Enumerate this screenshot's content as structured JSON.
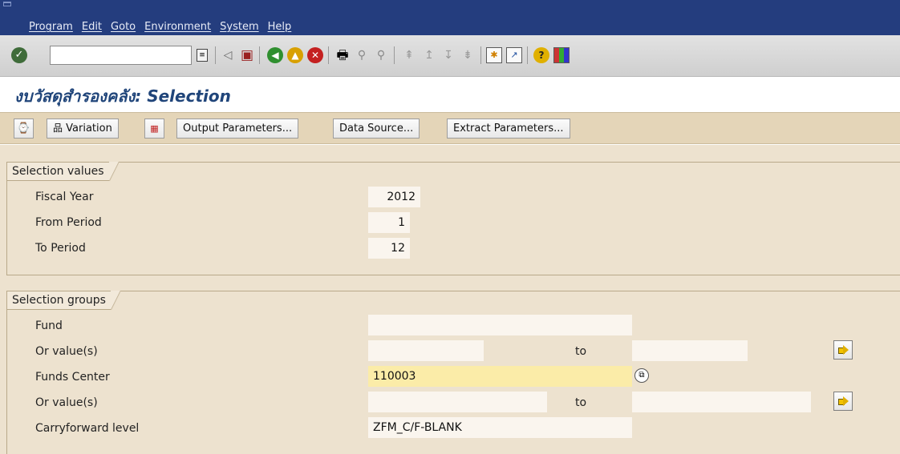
{
  "menu": [
    "Program",
    "Edit",
    "Goto",
    "Environment",
    "System",
    "Help"
  ],
  "toolbar": {
    "command_value": ""
  },
  "title": "งบวัสดุสำรองคลัง: Selection",
  "app_toolbar": {
    "variation_label": "Variation",
    "output_label": "Output Parameters...",
    "datasource_label": "Data Source...",
    "extract_label": "Extract Parameters..."
  },
  "selection_values": {
    "title": "Selection values",
    "fiscal_year_label": "Fiscal Year",
    "fiscal_year_value": "2012",
    "from_period_label": "From Period",
    "from_period_value": "1",
    "to_period_label": "To Period",
    "to_period_value": "12"
  },
  "selection_groups": {
    "title": "Selection groups",
    "fund_label": "Fund",
    "fund_value": "",
    "or_values_label": "Or value(s)",
    "to_label": "to",
    "funds_center_label": "Funds Center",
    "funds_center_value": "110003",
    "carryforward_label": "Carryforward level",
    "carryforward_value": "ZFM_C/F-BLANK"
  },
  "colors": {
    "menubar": "#243d7e",
    "title": "#20457a",
    "content_bg": "#ede2cf",
    "focus_field": "#fbeca8"
  }
}
